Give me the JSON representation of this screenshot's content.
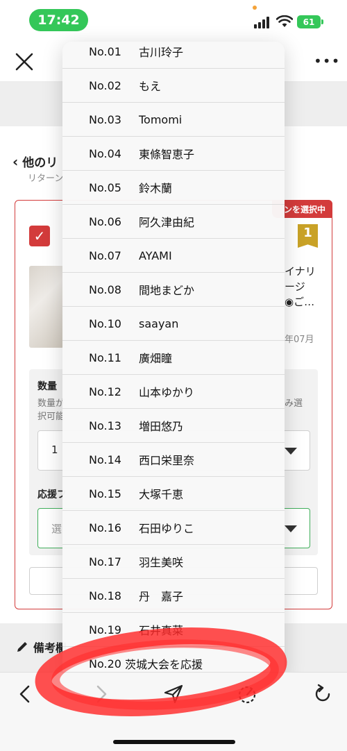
{
  "status_bar": {
    "time": "17:42",
    "battery": "61"
  },
  "page": {
    "back_label": "他のリ",
    "sub_label": "リターン",
    "selected_banner": "ンを選択中",
    "check_mark": "✓",
    "rank": "1",
    "product_text": [
      "イナリ",
      "ージ",
      "◉ご…"
    ],
    "product_date": "年07月",
    "quantity_title": "数量",
    "quantity_desc": "数量が択可能",
    "quantity_desc_right": "み選",
    "quantity_value": "1",
    "support_title": "応援フ",
    "support_placeholder": "選",
    "notes_label": "備考欄"
  },
  "dropdown": {
    "items": [
      {
        "no": "No.01",
        "name": "古川玲子"
      },
      {
        "no": "No.02",
        "name": "もえ"
      },
      {
        "no": "No.03",
        "name": "Tomomi"
      },
      {
        "no": "No.04",
        "name": "東條智恵子"
      },
      {
        "no": "No.05",
        "name": "鈴木蘭"
      },
      {
        "no": "No.06",
        "name": "阿久津由紀"
      },
      {
        "no": "No.07",
        "name": "AYAMI"
      },
      {
        "no": "No.08",
        "name": "間地まどか"
      },
      {
        "no": "No.10",
        "name": "saayan"
      },
      {
        "no": "No.11",
        "name": "廣畑瞳"
      },
      {
        "no": "No.12",
        "name": "山本ゆかり"
      },
      {
        "no": "No.13",
        "name": "増田悠乃"
      },
      {
        "no": "No.14",
        "name": "西口栄里奈"
      },
      {
        "no": "No.15",
        "name": "大塚千恵"
      },
      {
        "no": "No.16",
        "name": "石田ゆりこ"
      },
      {
        "no": "No.17",
        "name": "羽生美咲"
      },
      {
        "no": "No.18",
        "name": "丹　嘉子"
      },
      {
        "no": "No.19",
        "name": "石井真菜"
      },
      {
        "no": "No.20",
        "name": "茨城大会を応援"
      }
    ]
  },
  "toolbar": {
    "icons": [
      "chevron-left-icon",
      "chevron-right-icon",
      "send-icon",
      "timer-icon",
      "refresh-icon"
    ]
  },
  "colors": {
    "accent_red": "#d33b3b",
    "status_green": "#34c759",
    "field_green": "#3fae5a",
    "rank_gold": "#c9a227"
  }
}
